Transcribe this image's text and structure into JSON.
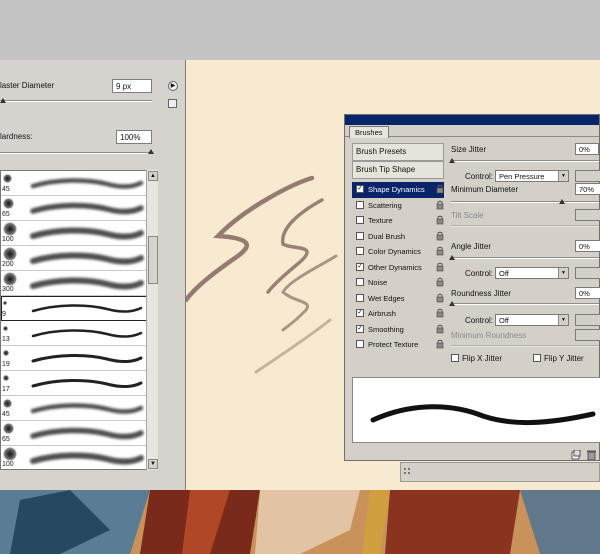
{
  "picker": {
    "master_diameter_label": "laster Diameter",
    "master_diameter_value": "9 px",
    "hardness_label": "lardness:",
    "hardness_value": "100%",
    "master_diameter_slider": 0.02,
    "hardness_slider": 1.0
  },
  "brush_list": [
    {
      "size": "45",
      "selected": false
    },
    {
      "size": "65",
      "selected": false
    },
    {
      "size": "100",
      "selected": false
    },
    {
      "size": "200",
      "selected": false
    },
    {
      "size": "300",
      "selected": false
    },
    {
      "size": "9",
      "selected": true
    },
    {
      "size": "13",
      "selected": false
    },
    {
      "size": "19",
      "selected": false
    },
    {
      "size": "17",
      "selected": false
    },
    {
      "size": "45",
      "selected": false
    },
    {
      "size": "65",
      "selected": false
    },
    {
      "size": "100",
      "selected": false
    }
  ],
  "brushes_panel": {
    "tab": "Brushes",
    "brush_presets": "Brush Presets",
    "brush_tip_shape": "Brush Tip Shape",
    "options": [
      {
        "label": "Shape Dynamics",
        "checked": true,
        "active": true
      },
      {
        "label": "Scattering",
        "checked": false,
        "active": false
      },
      {
        "label": "Texture",
        "checked": false,
        "active": false
      },
      {
        "label": "Dual Brush",
        "checked": false,
        "active": false
      },
      {
        "label": "Color Dynamics",
        "checked": false,
        "active": false
      },
      {
        "label": "Other Dynamics",
        "checked": true,
        "active": false
      },
      {
        "label": "Noise",
        "checked": false,
        "active": false
      },
      {
        "label": "Wet Edges",
        "checked": false,
        "active": false
      },
      {
        "label": "Airbrush",
        "checked": true,
        "active": false
      },
      {
        "label": "Smoothing",
        "checked": true,
        "active": false
      },
      {
        "label": "Protect Texture",
        "checked": false,
        "active": false
      }
    ],
    "size_jitter_label": "Size Jitter",
    "size_jitter_value": "0%",
    "control_label": "Control:",
    "size_control_value": "Pen Pressure",
    "minimum_diameter_label": "Minimum Diameter",
    "minimum_diameter_value": "70%",
    "tilt_scale_label": "Tilt Scale",
    "angle_jitter_label": "Angle Jitter",
    "angle_jitter_value": "0%",
    "angle_control_value": "Off",
    "roundness_jitter_label": "Roundness Jitter",
    "roundness_jitter_value": "0%",
    "roundness_control_value": "Off",
    "minimum_roundness_label": "Minimum Roundness",
    "flip_x_label": "Flip X Jitter",
    "flip_y_label": "Flip Y Jitter",
    "size_jitter_level": 0.0,
    "minimum_diameter_level": 0.7
  },
  "colors": {
    "canvas": "#f8ead0",
    "stroke": "#8a6e66",
    "panel": "#d4d0c8",
    "title_bar": "#0a246a"
  }
}
